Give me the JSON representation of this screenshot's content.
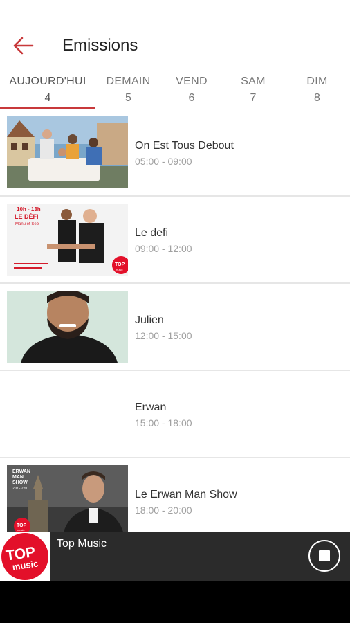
{
  "header": {
    "title": "Emissions"
  },
  "tabs": [
    {
      "label": "AUJOURD'HUI",
      "num": "4",
      "active": true
    },
    {
      "label": "DEMAIN",
      "num": "5"
    },
    {
      "label": "VEND",
      "num": "6"
    },
    {
      "label": "SAM",
      "num": "7"
    },
    {
      "label": "DIM",
      "num": "8"
    }
  ],
  "shows": [
    {
      "title": "On Est Tous Debout",
      "time": "05:00 - 09:00"
    },
    {
      "title": "Le defi",
      "time": "09:00 - 12:00",
      "thumb_text": {
        "line1": "10h - 13h",
        "line2": "LE DÉFI",
        "line3": "Manu et Seb",
        "logo_top": "TOP",
        "logo_music": "music"
      }
    },
    {
      "title": "Julien",
      "time": "12:00 - 15:00"
    },
    {
      "title": "Erwan",
      "time": "15:00 - 18:00"
    },
    {
      "title": "Le Erwan Man Show",
      "time": "18:00 - 20:00",
      "thumb_text": {
        "line1": "ERWAN",
        "line2": "MAN",
        "line3": "SHOW",
        "hours": "20h - 22h",
        "logo_top": "TOP",
        "logo_music": "music"
      }
    }
  ],
  "player": {
    "station": "Top Music",
    "logo_top": "TOP",
    "logo_music": "music"
  },
  "colors": {
    "accent": "#c8393b",
    "player_bg": "#2b2b2b",
    "logo_red": "#e3102a"
  }
}
